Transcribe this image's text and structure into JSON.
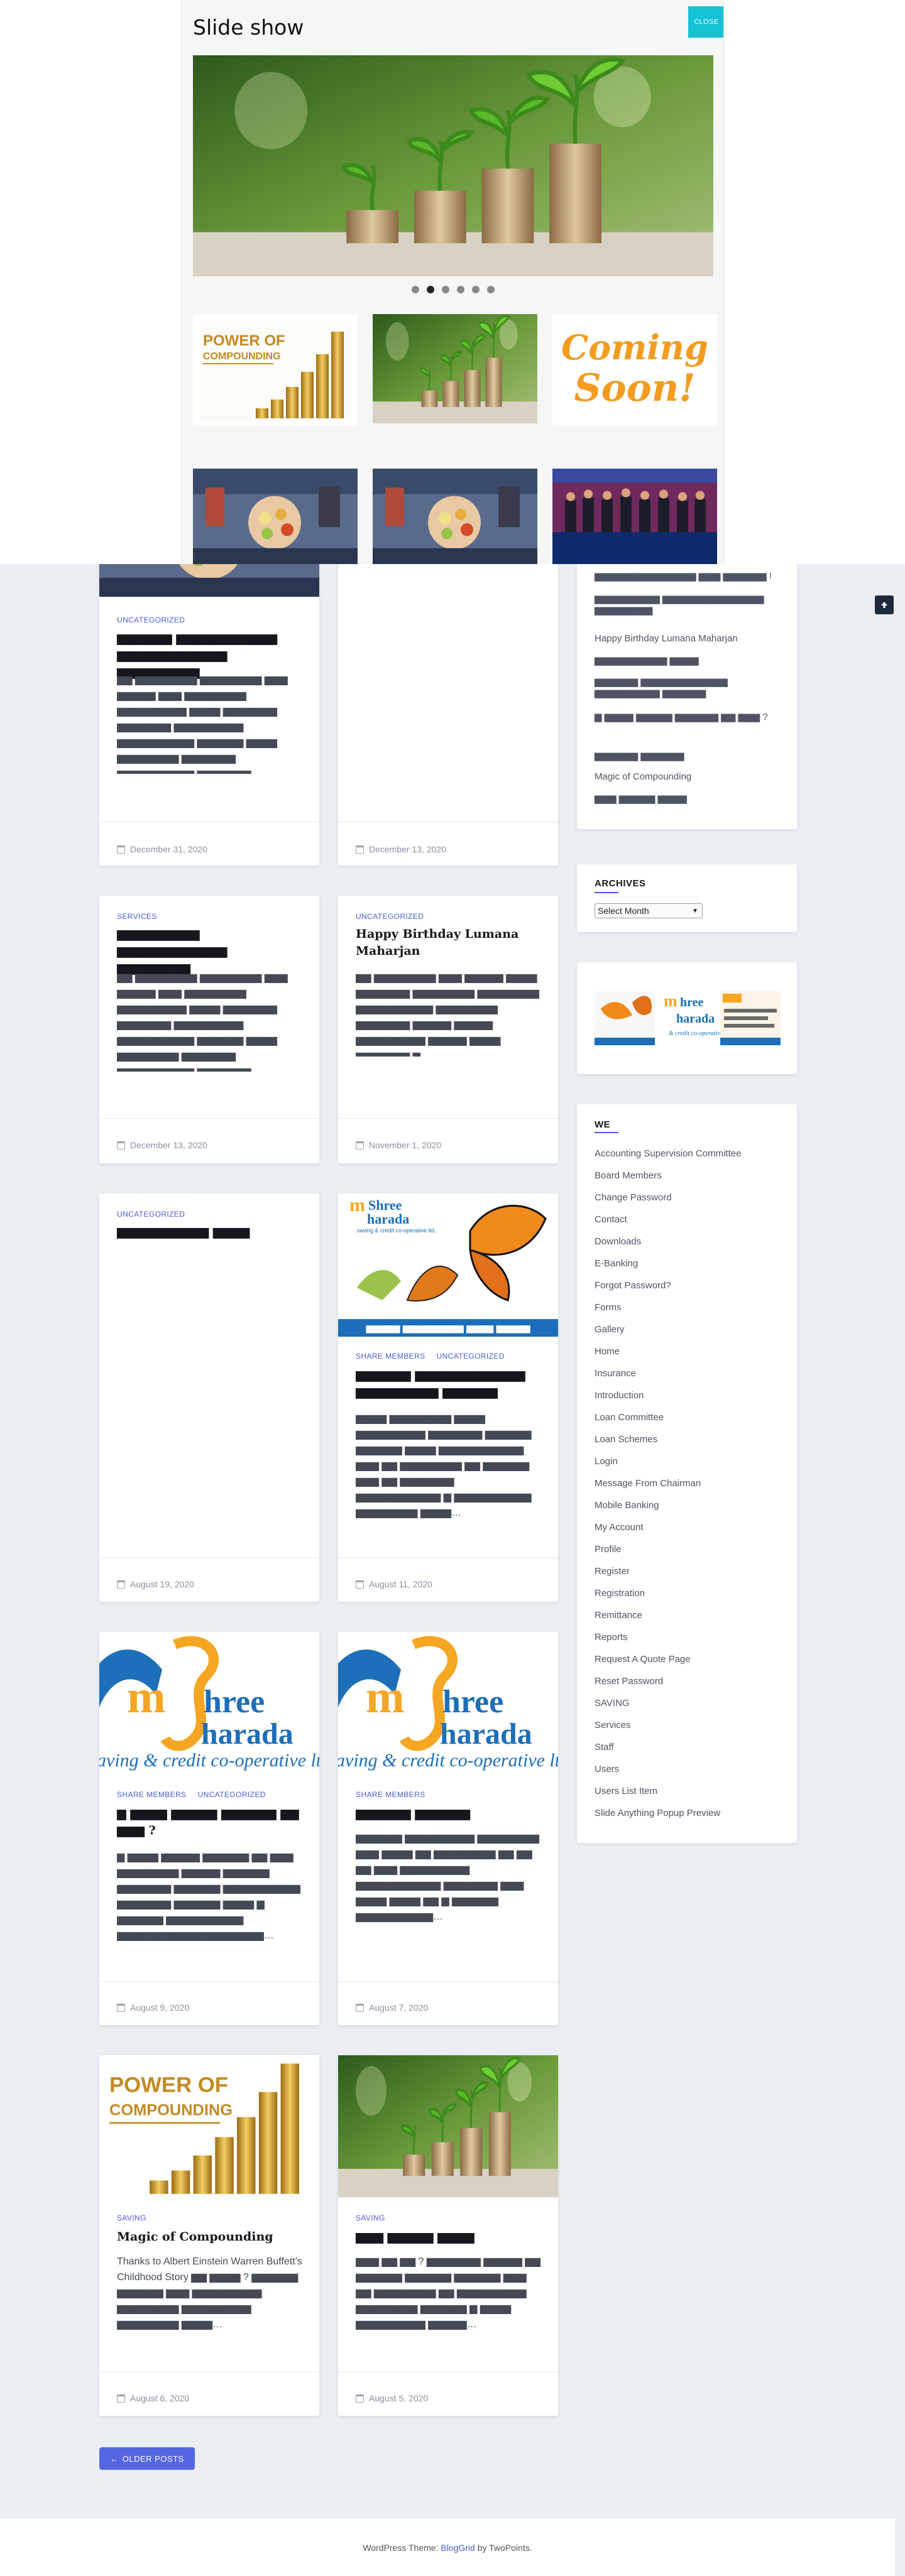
{
  "modal": {
    "title": "Slide show",
    "close_label": "CLOSE",
    "dots": [
      false,
      true,
      false,
      false,
      false,
      false
    ],
    "thumbs": [
      {
        "name": "power-of-compounding",
        "caption": ""
      },
      {
        "name": "coins-plants",
        "caption": ""
      },
      {
        "name": "coming-soon",
        "caption": "Coming Soon!"
      },
      {
        "name": "ceremony-1",
        "caption": ""
      },
      {
        "name": "ceremony-2",
        "caption": ""
      },
      {
        "name": "conference",
        "caption": ""
      }
    ],
    "compounding_text": {
      "line1": "POWER OF",
      "line2": "COMPOUNDING"
    },
    "coming_soon": {
      "line1": "Coming",
      "line2": "Soon!"
    }
  },
  "posts": [
    {
      "categories": [
        "UNCATEGORIZED"
      ],
      "title": "▆▆▆▆▆▆ ▆▆▆▆▆▆▆▆▆▆▆ ▆▆▆▆▆▆▆▆▆▆▆▆ ▆▆▆▆▆▆▆▆▆",
      "excerpt": "▆▆ ▆▆▆▆▆▆▆▆ ▆▆▆▆▆▆▆▆ ▆▆▆ ▆▆▆▆▆ ▆▆▆ ▆▆▆▆▆▆▆▆ ▆▆▆▆▆▆▆▆▆ ▆▆▆▆ ▆▆▆▆▆▆▆ ▆▆▆▆▆▆▆ ▆▆▆▆▆▆▆▆▆ ▆▆▆▆▆▆▆▆▆▆ ▆▆▆▆▆▆ ▆▆▆▆ ▆▆▆▆▆▆▆▆ ▆▆▆▆▆▆▆ ▆▆▆▆▆▆▆▆▆▆ ▆▆▆▆▆▆▆ ▆▆▆▆▆▆▆▆▆▆▆▆▆▆▆▆▆▆▆…",
      "date": "December 31, 2020"
    },
    {
      "categories": [],
      "title": "",
      "excerpt": "",
      "date": "December 13, 2020"
    },
    {
      "categories": [
        "SERVICES"
      ],
      "title": "▆▆▆▆▆▆▆▆▆ ▆▆▆▆▆▆▆▆▆▆▆▆ ▆▆▆▆▆▆▆▆",
      "excerpt": "▆▆ ▆▆▆▆▆▆▆▆ ▆▆▆▆▆▆▆▆ ▆▆▆ ▆▆▆▆▆ ▆▆▆ ▆▆▆▆▆▆▆▆ ▆▆▆▆▆▆▆▆▆ ▆▆▆▆ ▆▆▆▆▆▆▆ ▆▆▆▆▆▆▆ ▆▆▆▆▆▆▆▆▆ ▆▆▆▆▆▆▆▆▆▆ ▆▆▆▆▆▆ ▆▆▆▆ ▆▆▆▆▆▆▆▆ ▆▆▆▆▆▆▆ ▆▆▆▆▆▆▆▆▆▆ ▆▆▆▆▆▆▆ ▆▆▆▆▆▆▆▆▆▆▆▆▆▆▆▆▆▆▆…",
      "date": "December 13, 2020"
    },
    {
      "categories": [
        "UNCATEGORIZED"
      ],
      "title": "Happy Birthday Lumana Maharjan",
      "excerpt": "▆▆ ▆▆▆▆▆▆▆▆ ▆▆▆ ▆▆▆▆▆ ▆▆▆▆ ▆▆▆▆▆▆▆ ▆▆▆▆▆▆▆▆ ▆▆▆▆▆▆▆▆ ▆▆▆▆▆▆▆▆▆▆ ▆▆▆▆▆▆▆▆ ▆▆▆▆▆▆▆ ▆▆▆▆▆ ▆▆▆▆▆ ▆▆▆▆▆▆▆▆▆ ▆▆▆▆▆ ▆▆▆▆ ▆▆▆▆▆▆▆ ▆",
      "date": "November 1, 2020"
    },
    {
      "categories": [
        "UNCATEGORIZED"
      ],
      "title": "▆▆▆▆▆▆▆▆▆▆ ▆▆▆▆",
      "excerpt": "",
      "date": "August 19, 2020"
    },
    {
      "categories": [
        "SHARE MEMBERS",
        "UNCATEGORIZED"
      ],
      "title": "▆▆▆▆▆▆ ▆▆▆▆▆▆▆▆▆▆▆▆ ▆▆▆▆▆▆▆▆▆ ▆▆▆▆▆▆",
      "excerpt": "▆▆▆▆ ▆▆▆▆▆▆▆▆ ▆▆▆▆ ▆▆▆▆▆▆▆▆▆ ▆▆▆▆▆▆▆ ▆▆▆▆▆▆ ▆▆▆▆▆▆ ▆▆▆▆ ▆▆▆▆▆▆▆▆▆▆▆ ▆▆▆ ▆▆ ▆▆▆▆▆▆▆▆ ▆▆ ▆▆▆▆▆▆ ▆▆▆ ▆▆ ▆▆▆▆▆▆▆ ▆▆▆▆▆▆▆▆▆▆▆ ▆ ▆▆▆▆▆▆▆▆▆▆ ▆▆▆▆▆▆▆▆ ▆▆▆▆…",
      "date": "August 11, 2020"
    },
    {
      "categories": [
        "SHARE MEMBERS",
        "UNCATEGORIZED"
      ],
      "title": "▆ ▆▆▆▆ ▆▆▆▆▆ ▆▆▆▆▆▆ ▆▆ ▆▆▆ ?",
      "excerpt": "▆ ▆▆▆▆ ▆▆▆▆▆ ▆▆▆▆▆▆ ▆▆ ▆▆▆ ▆▆▆▆▆▆▆▆ ▆▆▆▆▆ ▆▆▆▆▆▆ ▆▆▆▆▆▆▆ ▆▆▆▆▆▆ ▆▆▆▆▆▆▆▆▆▆ ▆▆▆▆▆▆▆ ▆▆▆▆▆▆ ▆▆▆▆ ▆ ▆▆▆▆▆▆ ▆▆▆▆▆▆▆▆▆▆ ▆▆▆▆▆▆▆▆▆▆▆▆▆▆▆▆▆▆▆…",
      "date": "August 9, 2020"
    },
    {
      "categories": [
        "SHARE MEMBERS"
      ],
      "title": "▆▆▆▆▆▆ ▆▆▆▆▆▆",
      "excerpt": "▆▆▆▆▆▆ ▆▆▆▆▆▆▆▆▆ ▆▆▆▆▆▆▆▆ ▆▆▆ ▆▆▆▆ ▆▆ ▆▆▆▆▆▆▆▆ ▆▆ ▆▆ ▆▆ ▆▆▆ ▆▆▆▆▆▆▆▆▆ ▆▆▆▆▆▆▆▆▆▆▆ ▆▆▆▆▆▆▆ ▆▆▆ ▆▆▆▆ ▆▆▆▆ ▆▆ ▆ ▆▆▆▆▆▆ ▆▆▆▆▆▆▆▆▆▆…",
      "date": "August 7, 2020"
    },
    {
      "categories": [
        "SAVING"
      ],
      "title": "Magic of Compounding",
      "excerpt": "Thanks to Albert Einstein Warren Buffett's Childhood Story ▆▆ ▆▆▆▆ ? ▆▆▆▆▆▆ ▆▆▆▆▆▆ ▆▆▆ ▆▆▆▆▆▆▆▆▆ ▆▆▆▆▆▆▆▆ ▆▆▆▆▆▆▆▆▆ ▆▆▆▆▆▆▆▆ ▆▆▆▆…",
      "date": "August 6, 2020"
    },
    {
      "categories": [
        "SAVING"
      ],
      "title": "▆▆▆ ▆▆▆▆▆ ▆▆▆▆",
      "excerpt": "▆▆▆ ▆▆ ▆▆ ? ▆▆▆▆▆▆▆ ▆▆▆▆▆ ▆▆ ▆▆▆▆▆▆ ▆▆▆▆▆▆ ▆▆▆▆▆▆ ▆▆▆ ▆▆ ▆▆▆▆▆▆▆▆ ▆▆ ▆▆▆▆▆▆▆▆▆ ▆▆▆▆▆▆▆▆ ▆▆▆▆▆▆ ▆ ▆▆▆▆ ▆▆▆▆▆▆▆▆▆ ▆▆▆▆▆…",
      "date": "August 5, 2020"
    }
  ],
  "sidebar": {
    "recent": [
      "▆▆▆▆▆▆▆▆▆▆▆▆▆▆ ▆▆▆ ▆▆▆▆▆▆ !",
      "▆▆▆▆▆▆▆▆▆ ▆▆▆▆▆▆▆▆▆▆▆▆▆▆ ▆▆▆▆▆▆▆▆",
      "Happy Birthday Lumana Maharjan",
      "▆▆▆▆▆▆▆▆▆▆ ▆▆▆▆",
      "▆▆▆▆▆▆ ▆▆▆▆▆▆▆▆▆▆▆▆ ▆▆▆▆▆▆▆▆▆ ▆▆▆▆▆▆",
      "▆ ▆▆▆▆ ▆▆▆▆▆ ▆▆▆▆▆▆ ▆▆ ▆▆▆ ?",
      "▆▆▆▆▆▆ ▆▆▆▆▆▆",
      "Magic of Compounding",
      "▆▆▆ ▆▆▆▆▆ ▆▆▆▆"
    ],
    "archives_title": "ARCHIVES",
    "archives_select": "Select Month",
    "we_title": "WE",
    "pages": [
      "Accounting Supervision Committee",
      "Board Members",
      "Change Password",
      "Contact",
      "Downloads",
      "E-Banking",
      "Forgot Password?",
      "Forms",
      "Gallery",
      "Home",
      "Insurance",
      "Introduction",
      "Loan Committee",
      "Loan Schemes",
      "Login",
      "Message From Chairman",
      "Mobile Banking",
      "My Account",
      "Profile",
      "Register",
      "Registration",
      "Remittance",
      "Reports",
      "Request A Quote Page",
      "Reset Password",
      "SAVING",
      "Services",
      "Staff",
      "Users",
      "Users List Item",
      "Slide Anything Popup Preview"
    ]
  },
  "logo": {
    "name": "Shree Sharada",
    "tagline": "saving & credit co-operative ltd."
  },
  "pagination": {
    "older_label": "OLDER POSTS"
  },
  "footer": {
    "prefix": "WordPress Theme: ",
    "theme": "BlogGrid",
    "by": " by TwoPoints."
  },
  "colors": {
    "accent": "#4a5bd6",
    "close": "#16c1d3",
    "logo_orange": "#f5a623",
    "logo_blue": "#1c6fb8"
  }
}
